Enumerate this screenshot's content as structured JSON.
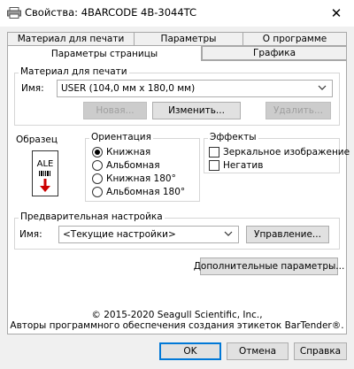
{
  "window": {
    "title": "Свойства: 4BARCODE 4B-3044TC",
    "close_glyph": "✕"
  },
  "tabs": {
    "row_back": [
      "Материал для печати",
      "Параметры",
      "О программе"
    ],
    "row_front": [
      "Параметры страницы",
      "Графика"
    ]
  },
  "media": {
    "group_label": "Материал для печати",
    "name_label": "Имя:",
    "name_value": "USER (104,0 мм x 180,0 мм)",
    "new_button": "Новая...",
    "edit_button": "Изменить...",
    "delete_button": "Удалить..."
  },
  "sample": {
    "label": "Образец",
    "preview_text": "ALE"
  },
  "orientation": {
    "label": "Ориентация",
    "options": [
      "Книжная",
      "Альбомная",
      "Книжная 180°",
      "Альбомная 180°"
    ],
    "selected": 0
  },
  "effects": {
    "label": "Эффекты",
    "mirror": "Зеркальное изображение",
    "negative": "Негатив"
  },
  "preset": {
    "group_label": "Предварительная настройка",
    "name_label": "Имя:",
    "name_value": "<Текущие настройки>",
    "manage_button": "Управление..."
  },
  "advanced_button": "Дополнительные параметры...",
  "footer": {
    "copyright": "© 2015-2020 Seagull Scientific, Inc.,",
    "authors": "Авторы программного обеспечения создания этикеток BarTender®."
  },
  "dialog_buttons": {
    "ok": "OK",
    "cancel": "Отмена",
    "help": "Справка"
  },
  "colors": {
    "accent": "#0078d7",
    "preview_arrow": "#cc0000"
  }
}
